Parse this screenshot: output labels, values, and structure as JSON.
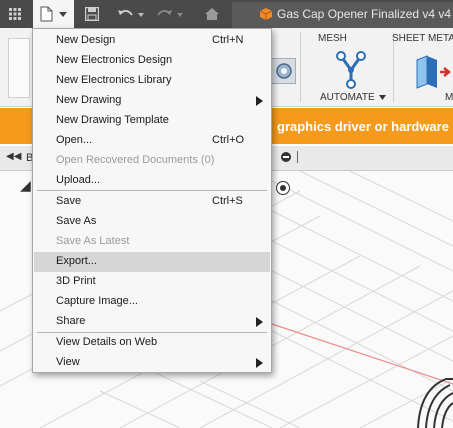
{
  "appbar": {
    "document_title": "Gas Cap Opener Finalized v4 v4"
  },
  "ribbon": {
    "mesh_label": "MESH",
    "sheet_metal_label": "SHEET METAL",
    "automate_label": "AUTOMATE",
    "m_label": "M"
  },
  "notice": {
    "text": "graphics driver or hardware"
  },
  "file_menu": {
    "items": [
      {
        "label": "New Design",
        "shortcut": "Ctrl+N",
        "enabled": true
      },
      {
        "label": "New Electronics Design",
        "shortcut": "",
        "enabled": true
      },
      {
        "label": "New Electronics Library",
        "shortcut": "",
        "enabled": true
      },
      {
        "label": "New Drawing",
        "shortcut": "",
        "enabled": true,
        "submenu": true
      },
      {
        "label": "New Drawing Template",
        "shortcut": "",
        "enabled": true
      },
      {
        "label": "Open...",
        "shortcut": "Ctrl+O",
        "enabled": true
      },
      {
        "label": "Open Recovered Documents (0)",
        "shortcut": "",
        "enabled": false
      },
      {
        "label": "Upload...",
        "shortcut": "",
        "enabled": true
      },
      {
        "label": "Save",
        "shortcut": "Ctrl+S",
        "enabled": true
      },
      {
        "label": "Save As",
        "shortcut": "",
        "enabled": true
      },
      {
        "label": "Save As Latest",
        "shortcut": "",
        "enabled": false
      },
      {
        "label": "Export...",
        "shortcut": "",
        "enabled": true,
        "highlighted": true
      },
      {
        "label": "3D Print",
        "shortcut": "",
        "enabled": true
      },
      {
        "label": "Capture Image...",
        "shortcut": "",
        "enabled": true
      },
      {
        "label": "Share",
        "shortcut": "",
        "enabled": true,
        "submenu": true
      },
      {
        "label": "View Details on Web",
        "shortcut": "",
        "enabled": true
      },
      {
        "label": "View",
        "shortcut": "",
        "enabled": true,
        "submenu": true
      }
    ]
  },
  "browser": {
    "partial_label": "B"
  },
  "colors": {
    "notice_bg": "#f59a1b",
    "appbar_bg": "#4a4a4a",
    "menu_bg": "#f7f7f7",
    "menu_highlight": "#d6d6d6",
    "disabled_text": "#9a9a9a"
  }
}
